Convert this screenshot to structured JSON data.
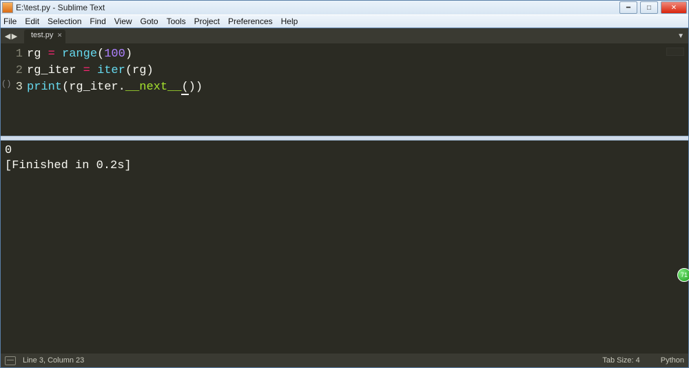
{
  "window": {
    "title": "E:\\test.py - Sublime Text"
  },
  "menu": {
    "items": [
      "File",
      "Edit",
      "Selection",
      "Find",
      "View",
      "Goto",
      "Tools",
      "Project",
      "Preferences",
      "Help"
    ]
  },
  "tabs": {
    "active": "test.py"
  },
  "code": {
    "lines": [
      "1",
      "2",
      "3"
    ],
    "l1": {
      "a": "rg ",
      "op": "=",
      "b": " ",
      "fn": "range",
      "p1": "(",
      "num": "100",
      "p2": ")"
    },
    "l2": {
      "a": "rg_iter ",
      "op": "=",
      "b": " ",
      "fn": "iter",
      "p1": "(",
      "arg": "rg",
      "p2": ")"
    },
    "l3": {
      "fn": "print",
      "p1": "(",
      "obj": "rg_iter",
      "dot": ".",
      "call": "__next__",
      "p2": "(",
      "p3": ")",
      "p4": ")"
    }
  },
  "output": {
    "line1": "0",
    "line2": "[Finished in 0.2s]"
  },
  "status": {
    "pos": "Line 3, Column 23",
    "tab": "Tab Size: 4",
    "lang": "Python"
  },
  "badge": {
    "txt": "71"
  }
}
